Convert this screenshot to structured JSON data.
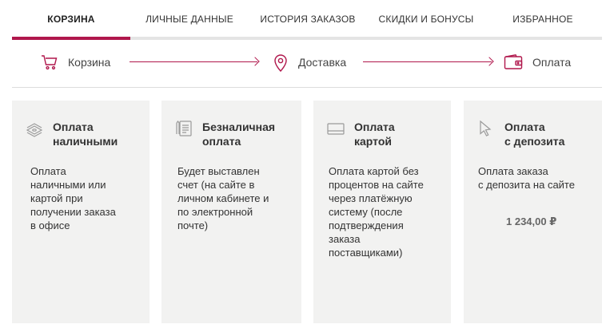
{
  "tabs": [
    {
      "label": "КОРЗИНА",
      "active": true
    },
    {
      "label": "ЛИЧНЫЕ ДАННЫЕ",
      "active": false
    },
    {
      "label": "ИСТОРИЯ ЗАКАЗОВ",
      "active": false
    },
    {
      "label": "СКИДКИ И БОНУСЫ",
      "active": false
    },
    {
      "label": "ИЗБРАННОЕ",
      "active": false
    }
  ],
  "steps": [
    {
      "label": "Корзина",
      "icon": "cart-icon"
    },
    {
      "label": "Доставка",
      "icon": "location-pin-icon"
    },
    {
      "label": "Оплата",
      "icon": "wallet-icon"
    }
  ],
  "payment_options": [
    {
      "title": "Оплата\nналичными",
      "description": "Оплата\nналичными или\nкартой при\nполучении заказа\nв офисе",
      "icon": "cash-icon"
    },
    {
      "title": "Безналичная\nоплата",
      "description": "Будет выставлен\nсчет (на сайте в\nличном кабинете и\nпо электронной\nпочте)",
      "icon": "invoice-icon"
    },
    {
      "title": "Оплата\nкартой",
      "description": "Оплата картой без\nпроцентов на сайте\nчерез платёжную\nсистему (после\nподтверждения\nзаказа\nпоставщиками)",
      "icon": "credit-card-icon"
    },
    {
      "title": "Оплата\nс депозита",
      "description": "Оплата заказа\nс депозита на сайте",
      "amount": "1 234,00 ₽",
      "icon": "cursor-icon"
    }
  ],
  "colors": {
    "accent": "#b0174c",
    "card_bg": "#f2f2f1"
  }
}
